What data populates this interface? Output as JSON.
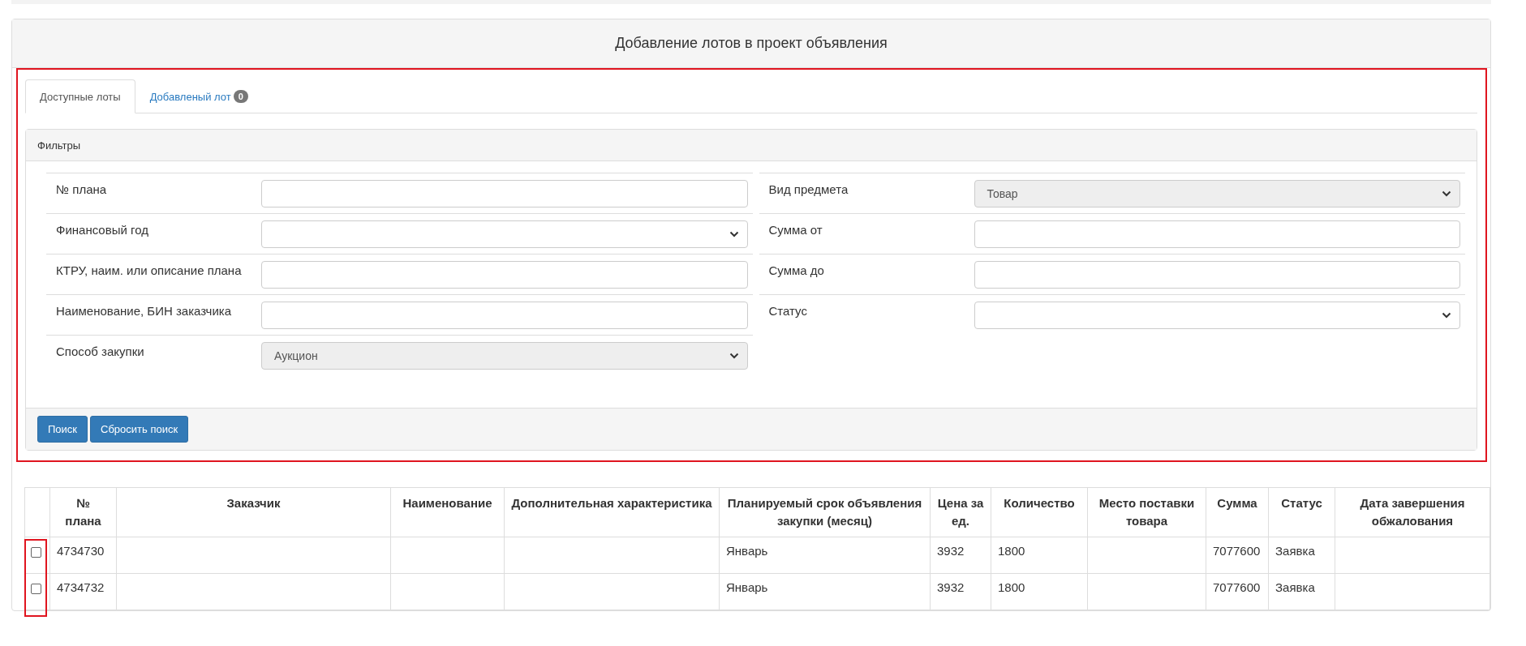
{
  "title": "Добавление лотов в проект объявления",
  "tabs": [
    {
      "label": "Доступные лоты",
      "selected": true
    },
    {
      "label": "Добавленый лот",
      "selected": false,
      "badge": "0"
    }
  ],
  "filters": {
    "title": "Фильтры",
    "left": [
      {
        "label": "№ плана",
        "kind": "text",
        "disabled": false
      },
      {
        "label": "Финансовый год",
        "kind": "select",
        "disabled": false
      },
      {
        "label": "КТРУ, наим. или описание плана",
        "kind": "text",
        "disabled": false
      },
      {
        "label": "Наименование, БИН заказчика",
        "kind": "text",
        "disabled": false
      },
      {
        "label": "Способ закупки",
        "kind": "select",
        "value": "Аукцион",
        "disabled": true
      }
    ],
    "right": [
      {
        "label": "Вид предмета",
        "kind": "select",
        "value": "Товар",
        "disabled": true
      },
      {
        "label": "Сумма от",
        "kind": "text",
        "disabled": false
      },
      {
        "label": "Сумма до",
        "kind": "text",
        "disabled": false
      },
      {
        "label": "Статус",
        "kind": "select",
        "disabled": false
      }
    ],
    "buttons": [
      "Поиск",
      "Сбросить поиск"
    ]
  },
  "table": {
    "columns": [
      "№ плана",
      "Заказчик",
      "Наименование",
      "Дополнительная характеристика",
      "Планируемый срок объявления закупки (месяц)",
      "Цена за ед.",
      "Количество",
      "Место поставки товара",
      "Сумма",
      "Статус",
      "Дата завершения обжалования"
    ],
    "rows": [
      {
        "checked": false,
        "plan_no": "4734730",
        "month": "Январь",
        "price": "3932",
        "quantity": "1800",
        "sum": "7077600",
        "status": "Заявка"
      },
      {
        "checked": false,
        "plan_no": "4734732",
        "month": "Январь",
        "price": "3932",
        "quantity": "1800",
        "sum": "7077600",
        "status": "Заявка"
      }
    ]
  }
}
